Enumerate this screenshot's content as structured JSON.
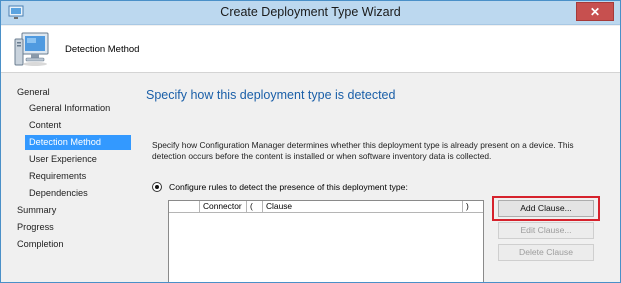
{
  "window": {
    "title": "Create Deployment Type Wizard",
    "close_symbol": "✕",
    "icon": "wizard-app-icon"
  },
  "header": {
    "step_title": "Detection Method",
    "icon": "computer-icon"
  },
  "sidebar": {
    "items": [
      {
        "label": "General",
        "level": 0,
        "active": false
      },
      {
        "label": "General Information",
        "level": 1,
        "active": false
      },
      {
        "label": "Content",
        "level": 1,
        "active": false
      },
      {
        "label": "Detection Method",
        "level": 1,
        "active": true
      },
      {
        "label": "User Experience",
        "level": 1,
        "active": false
      },
      {
        "label": "Requirements",
        "level": 1,
        "active": false
      },
      {
        "label": "Dependencies",
        "level": 1,
        "active": false
      },
      {
        "label": "Summary",
        "level": 0,
        "active": false
      },
      {
        "label": "Progress",
        "level": 0,
        "active": false
      },
      {
        "label": "Completion",
        "level": 0,
        "active": false
      }
    ]
  },
  "main": {
    "heading": "Specify how this deployment type is detected",
    "description": "Specify how Configuration Manager determines whether this deployment type is already present on a device. This detection occurs before the content is installed or when software inventory data is collected.",
    "radio_label": "Configure rules to detect the presence of this deployment type:",
    "radio_selected": true,
    "table_columns": [
      "",
      "Connector",
      "(",
      "Clause",
      ")"
    ],
    "buttons": {
      "add_clause": "Add Clause...",
      "edit_clause": "Edit Clause...",
      "delete_clause": "Delete Clause"
    }
  },
  "colors": {
    "selection": "#3399ff",
    "heading": "#1a5fa8",
    "highlight": "#d6222c",
    "close": "#c7504f"
  }
}
